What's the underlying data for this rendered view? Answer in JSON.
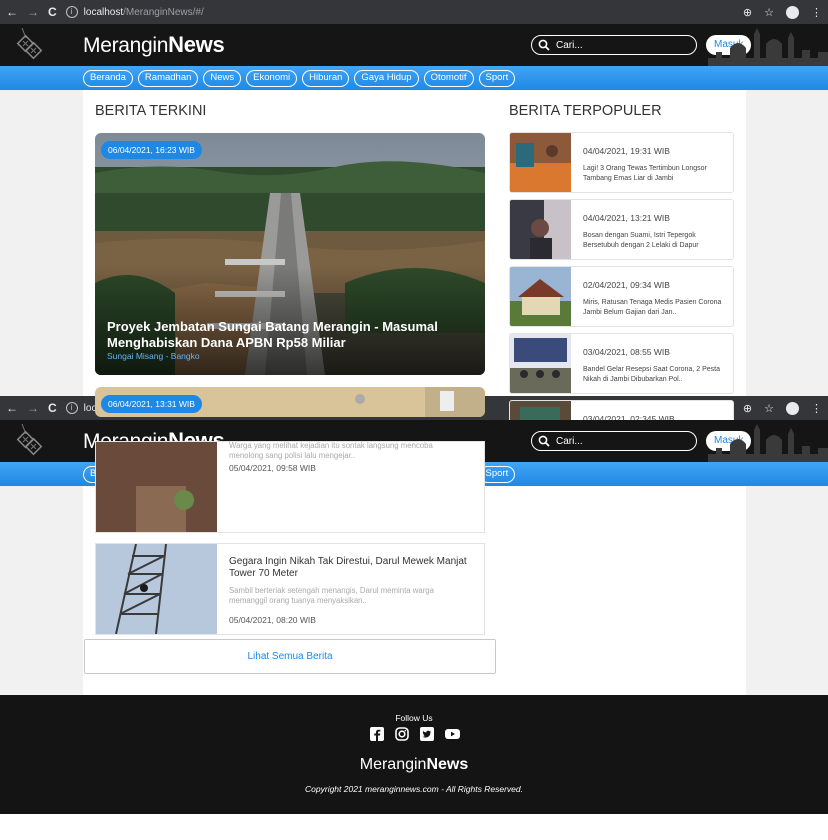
{
  "browser": {
    "back": "←",
    "forward": "→",
    "reload": "C",
    "url_host": "localhost",
    "url_path": "/MeranginNews/#/"
  },
  "site": {
    "logo_light": "Merangin",
    "logo_bold": "News",
    "search_placeholder": "Cari...",
    "login_label": "Masuk",
    "categories": [
      "Beranda",
      "Ramadhan",
      "News",
      "Ekonomi",
      "Hiburan",
      "Gaya Hidup",
      "Otomotif",
      "Sport"
    ]
  },
  "latest": {
    "heading": "BERITA TERKINI",
    "featured": [
      {
        "date": "06/04/2021, 16:23 WIB",
        "title": "Proyek Jembatan Sungai Batang Merangin - Masumal Menghabiskan Dana APBN Rp58 Miliar",
        "location": "Sungai Misang - Bangko"
      },
      {
        "date": "06/04/2021, 13:31 WIB"
      }
    ],
    "list": [
      {
        "excerpt": "Warga yang melihat kejadian itu sontak langsung mencoba menolong sang polisi lalu mengejar..",
        "date": "05/04/2021, 09:58 WIB"
      },
      {
        "title": "Gegara Ingin Nikah Tak Direstui, Darul Mewek Manjat Tower 70 Meter",
        "excerpt": "Sambil berteriak setengah menangis, Darul meminta warga memanggil orang tuanya menyaksikan..",
        "date": "05/04/2021, 08:20 WIB"
      }
    ],
    "see_all": "Lihat Semua Berita"
  },
  "popular": {
    "heading": "BERITA TERPOPULER",
    "items": [
      {
        "date": "04/04/2021, 19:31 WIB",
        "title": "Lagi! 3 Orang Tewas Tertimbun Longsor Tambang Emas Liar di Jambi"
      },
      {
        "date": "04/04/2021, 13:21 WIB",
        "title": "Bosan dengan Suami, Istri Tepergok Bersetubuh dengan 2 Lelaki di Dapur"
      },
      {
        "date": "02/04/2021, 09:34 WIB",
        "title": "Miris, Ratusan Tenaga Medis Pasien Corona Jambi Belum Gajian dari Jan.."
      },
      {
        "date": "03/04/2021, 08:55 WIB",
        "title": "Bandel Gelar Resepsi Saat Corona, 2 Pesta Nikah di Jambi Dibubarkan Pol.."
      },
      {
        "date": "03/04/2021, 02:345 WIB"
      }
    ]
  },
  "footer": {
    "follow_label": "Follow Us",
    "social_icons": [
      "facebook-icon",
      "instagram-icon",
      "twitter-icon",
      "youtube-icon"
    ],
    "logo_light": "Merangin",
    "logo_bold": "News",
    "copyright": "Copyright 2021 meranginnews.com - All Rights Reserved."
  }
}
